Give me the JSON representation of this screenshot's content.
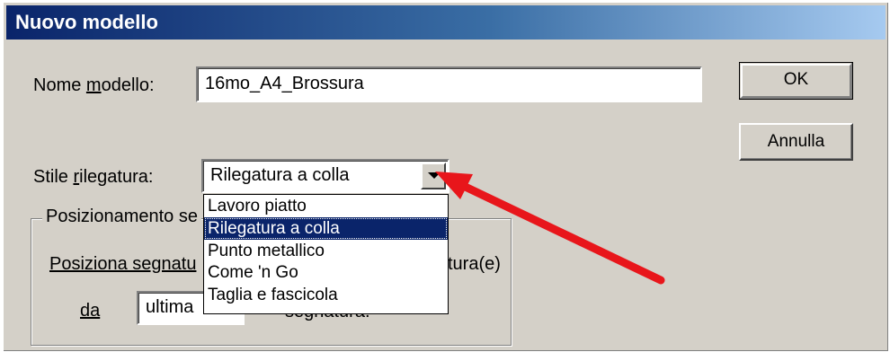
{
  "dialog": {
    "title": "Nuovo modello",
    "template_name_label": "Nome modello:",
    "template_name_value": "16mo_A4_Brossura",
    "binding_label": "Stile rilegatura:",
    "binding_value": "Rilegatura a colla",
    "binding_options": [
      "Lavoro piatto",
      "Rilegatura a colla",
      "Punto metallico",
      "Come 'n Go",
      "Taglia e fascicola"
    ],
    "binding_selected_index": 1,
    "group_label": "Posizionamento se",
    "position_label": "Posiziona segnatu",
    "position_suffix": "tura(e)",
    "from_label": "da",
    "from_value": "ultima",
    "signatures_label": "segnatura."
  },
  "buttons": {
    "ok": "OK",
    "cancel": "Annulla"
  },
  "annotation": {
    "arrow_color": "#e8161b"
  }
}
